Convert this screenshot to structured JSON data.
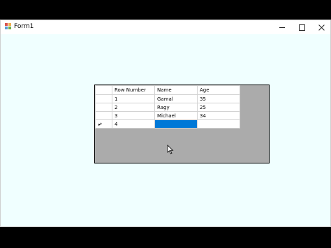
{
  "window": {
    "title": "Form1",
    "icon": "winforms-app-icon",
    "controls": {
      "minimize": "minimize-icon",
      "maximize": "maximize-icon",
      "close": "close-icon"
    }
  },
  "grid": {
    "columns": [
      "Row Number",
      "Name",
      "Age"
    ],
    "rows": [
      {
        "row_number": "1",
        "name": "Gamal",
        "age": "35"
      },
      {
        "row_number": "2",
        "name": "Ragy",
        "age": "25"
      },
      {
        "row_number": "3",
        "name": "Michael",
        "age": "34"
      }
    ],
    "new_row": {
      "row_number": "4",
      "name": "",
      "age": ""
    },
    "new_row_marker": "▸*",
    "selected_cell": "new_row.name"
  },
  "colors": {
    "form_background": "#f0ffff",
    "grid_background": "#ababab",
    "selection": "#0078d7"
  }
}
